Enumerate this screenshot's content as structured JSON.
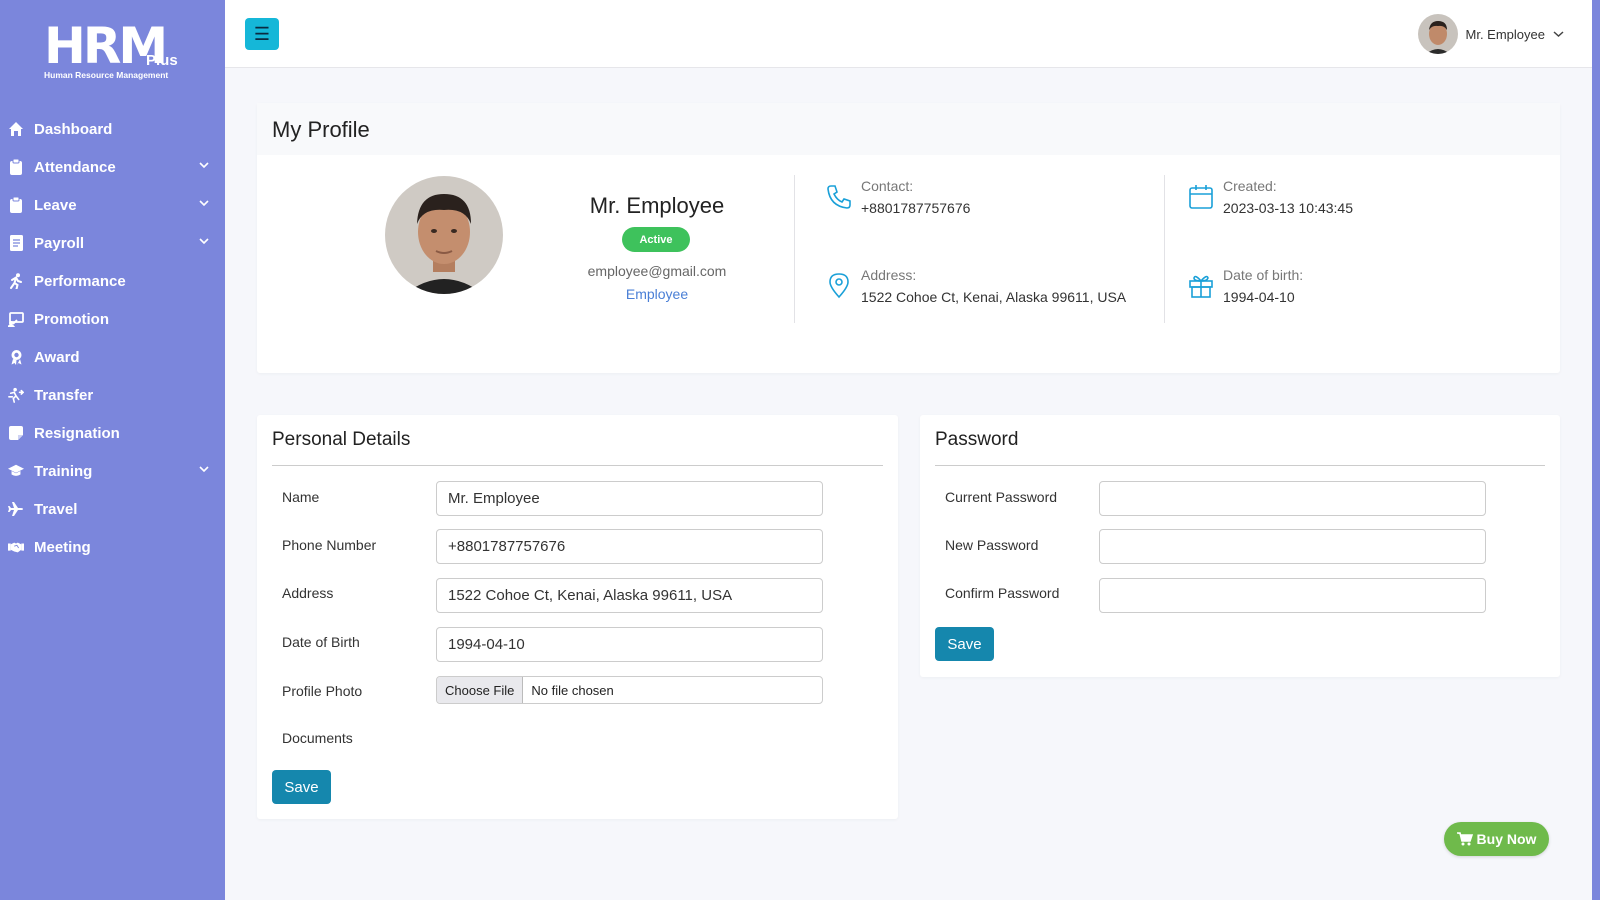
{
  "brand": {
    "logo_text": "HRM",
    "logo_plus": "Plus",
    "logo_sub": "Human Resource Management"
  },
  "sidebar": {
    "items": [
      {
        "label": "Dashboard",
        "icon": "home-icon",
        "expandable": false
      },
      {
        "label": "Attendance",
        "icon": "clipboard-icon",
        "expandable": true
      },
      {
        "label": "Leave",
        "icon": "clipboard-icon",
        "expandable": true
      },
      {
        "label": "Payroll",
        "icon": "document-icon",
        "expandable": true
      },
      {
        "label": "Performance",
        "icon": "running-icon",
        "expandable": false
      },
      {
        "label": "Promotion",
        "icon": "presentation-icon",
        "expandable": false
      },
      {
        "label": "Award",
        "icon": "award-icon",
        "expandable": false
      },
      {
        "label": "Transfer",
        "icon": "transfer-icon",
        "expandable": false
      },
      {
        "label": "Resignation",
        "icon": "note-icon",
        "expandable": false
      },
      {
        "label": "Training",
        "icon": "graduation-cap-icon",
        "expandable": true
      },
      {
        "label": "Travel",
        "icon": "plane-icon",
        "expandable": false
      },
      {
        "label": "Meeting",
        "icon": "handshake-icon",
        "expandable": false
      }
    ]
  },
  "topbar": {
    "menu_icon": "☰",
    "user_name": "Mr. Employee"
  },
  "profile": {
    "title": "My Profile",
    "name": "Mr. Employee",
    "status": "Active",
    "email": "employee@gmail.com",
    "role": "Employee",
    "contact_label": "Contact:",
    "contact_value": "+8801787757676",
    "address_label": "Address:",
    "address_value": "1522 Cohoe Ct, Kenai, Alaska 99611, USA",
    "created_label": "Created:",
    "created_value": "2023-03-13 10:43:45",
    "dob_label": "Date of birth:",
    "dob_value": "1994-04-10"
  },
  "personal": {
    "title": "Personal Details",
    "name_label": "Name",
    "name_value": "Mr. Employee",
    "phone_label": "Phone Number",
    "phone_value": "+8801787757676",
    "address_label": "Address",
    "address_value": "1522 Cohoe Ct, Kenai, Alaska 99611, USA",
    "dob_label": "Date of Birth",
    "dob_value": "1994-04-10",
    "photo_label": "Profile Photo",
    "file_button": "Choose File",
    "file_status": "No file chosen",
    "documents_label": "Documents",
    "save_label": "Save"
  },
  "password": {
    "title": "Password",
    "current_label": "Current Password",
    "new_label": "New Password",
    "confirm_label": "Confirm Password",
    "save_label": "Save"
  },
  "buy_now": "Buy Now",
  "colors": {
    "sidebar": "#7b86dc",
    "accent": "#15b7d8",
    "button": "#1587ad",
    "active": "#3ec25c",
    "buy": "#6fba4b",
    "link": "#4a7fd6"
  }
}
